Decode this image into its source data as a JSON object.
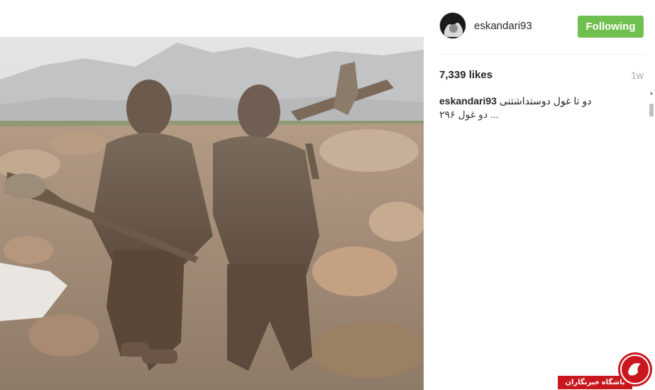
{
  "post": {
    "username": "eskandari93",
    "follow_label": "Following",
    "likes": "7,339 likes",
    "timestamp": "1w",
    "comments": [
      {
        "author": "eskandari93",
        "text": "دو تا غول دوستداشتنی"
      },
      {
        "author": "",
        "text": "دو غول ۲۹۶ ..."
      }
    ]
  },
  "colors": {
    "follow_button": "#70c050",
    "watermark_red": "#c8181e"
  },
  "watermark": {
    "text": "باشگاه خبرنگاران"
  },
  "icons": {
    "scroll_up": "scroll-up-arrow-icon"
  }
}
